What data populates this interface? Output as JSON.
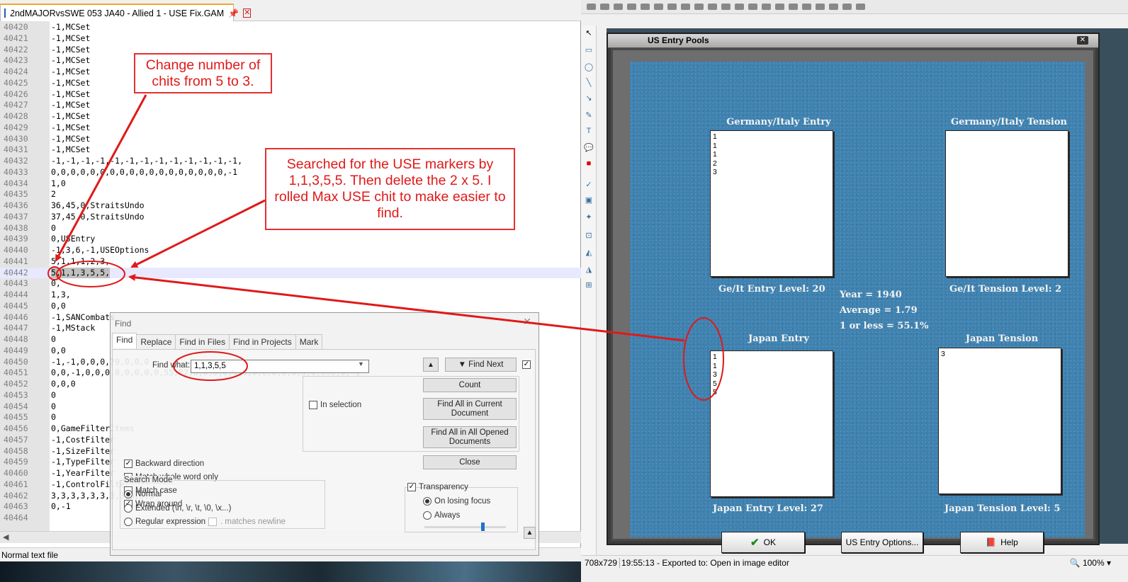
{
  "editor_file": {
    "tab_title": "2ndMAJORvsSWE 053 JA40 - Allied 1 - USE Fix.GAM",
    "status": "Normal text file",
    "lines": [
      {
        "n": "40420",
        "t": "-1,MCSet"
      },
      {
        "n": "40421",
        "t": "-1,MCSet"
      },
      {
        "n": "40422",
        "t": "-1,MCSet"
      },
      {
        "n": "40423",
        "t": "-1,MCSet"
      },
      {
        "n": "40424",
        "t": "-1,MCSet"
      },
      {
        "n": "40425",
        "t": "-1,MCSet"
      },
      {
        "n": "40426",
        "t": "-1,MCSet"
      },
      {
        "n": "40427",
        "t": "-1,MCSet"
      },
      {
        "n": "40428",
        "t": "-1,MCSet"
      },
      {
        "n": "40429",
        "t": "-1,MCSet"
      },
      {
        "n": "40430",
        "t": "-1,MCSet"
      },
      {
        "n": "40431",
        "t": "-1,MCSet"
      },
      {
        "n": "40432",
        "t": "-1,-1,-1,-1,-1,-1,-1,-1,-1,-1,-1,-1,-1,"
      },
      {
        "n": "40433",
        "t": "0,0,0,0,0,0,0,0,0,0,0,0,0,0,0,0,0,0,-1"
      },
      {
        "n": "40434",
        "t": "1,0"
      },
      {
        "n": "40435",
        "t": "2"
      },
      {
        "n": "40436",
        "t": "36,45,0,StraitsUndo"
      },
      {
        "n": "40437",
        "t": "37,45,0,StraitsUndo"
      },
      {
        "n": "40438",
        "t": "0"
      },
      {
        "n": "40439",
        "t": "0,USEntry"
      },
      {
        "n": "40440",
        "t": "-1,3,6,-1,USEOptions"
      },
      {
        "n": "40441",
        "t": "5,1,1,1,2,3,"
      },
      {
        "n": "40442",
        "t": "5,1,1,3,5,5,"
      },
      {
        "n": "40443",
        "t": "0,"
      },
      {
        "n": "40444",
        "t": "1,3,"
      },
      {
        "n": "40445",
        "t": "0,0"
      },
      {
        "n": "40446",
        "t": "-1,SANCombats"
      },
      {
        "n": "40447",
        "t": "-1,MStack"
      },
      {
        "n": "40448",
        "t": "0"
      },
      {
        "n": "40449",
        "t": "0,0"
      },
      {
        "n": "40450",
        "t": "-1,-1,0,0,0,79,0,0,0"
      },
      {
        "n": "40451",
        "t": "0,0,-1,0,0,0,0,0,0,0,0,55,82,0,0,0,0,0,0,0,0,0,0,0,0,0,0,0,0,-1"
      },
      {
        "n": "40452",
        "t": "0,0,0"
      },
      {
        "n": "40453",
        "t": "0"
      },
      {
        "n": "40454",
        "t": "0"
      },
      {
        "n": "40455",
        "t": "0"
      },
      {
        "n": "40456",
        "t": "0,GameFilterItems"
      },
      {
        "n": "40457",
        "t": "-1,CostFilter"
      },
      {
        "n": "40458",
        "t": "-1,SizeFilter"
      },
      {
        "n": "40459",
        "t": "-1,TypeFilter"
      },
      {
        "n": "40460",
        "t": "-1,YearFilter"
      },
      {
        "n": "40461",
        "t": "-1,ControlFilter"
      },
      {
        "n": "40462",
        "t": "3,3,3,3,3,3,3,3,3,3,3"
      },
      {
        "n": "40463",
        "t": "0,-1"
      },
      {
        "n": "40464",
        "t": ""
      }
    ]
  },
  "find_dialog": {
    "title": "Find",
    "tabs": [
      "Find",
      "Replace",
      "Find in Files",
      "Find in Projects",
      "Mark"
    ],
    "find_what_label": "Find what:",
    "find_what_value": "1,1,3,5,5",
    "buttons": {
      "find_next": "▼ Find Next",
      "count": "Count",
      "find_all_current": "Find All in Current Document",
      "find_all_opened": "Find All in All Opened Documents",
      "close": "Close"
    },
    "in_selection": "In selection",
    "options": [
      {
        "label": "Backward direction",
        "checked": true
      },
      {
        "label": "Match whole word only",
        "checked": false
      },
      {
        "label": "Match case",
        "checked": false
      },
      {
        "label": "Wrap around",
        "checked": true
      }
    ],
    "search_mode_label": "Search Mode",
    "search_modes": [
      {
        "label": "Normal",
        "selected": true
      },
      {
        "label": "Extended (\\n, \\r, \\t, \\0, \\x...)",
        "selected": false
      },
      {
        "label": "Regular expression",
        "selected": false
      }
    ],
    "matches_newline": ". matches newline",
    "transparency_label": "Transparency",
    "transparency_modes": [
      {
        "label": "On losing focus",
        "selected": true
      },
      {
        "label": "Always",
        "selected": false
      }
    ]
  },
  "image_editor": {
    "status_size": "708x729",
    "status_msg": "19:55:13 - Exported to: Open in image editor",
    "zoom": "100%"
  },
  "us_entry_pools": {
    "title": "US Entry Pools",
    "ge_it_entry": {
      "header": "Germany/Italy Entry",
      "chits": [
        "1",
        "1",
        "1",
        "2",
        "3"
      ],
      "level": "Ge/It Entry Level: 20"
    },
    "ge_it_tension": {
      "header": "Germany/Italy Tension",
      "chits": [],
      "level": "Ge/It Tension Level: 2"
    },
    "japan_entry": {
      "header": "Japan Entry",
      "chits": [
        "1",
        "1",
        "3",
        "5",
        "5"
      ],
      "level": "Japan Entry Level: 27"
    },
    "japan_tension": {
      "header": "Japan Tension",
      "chits": [
        "3"
      ],
      "level": "Japan Tension Level: 5"
    },
    "stats": {
      "year": "Year = 1940",
      "average": "Average = 1.79",
      "one_or_less": "1 or less = 55.1%"
    },
    "buttons": {
      "ok": "OK",
      "options": "US Entry Options...",
      "help": "Help"
    }
  },
  "annotations": {
    "callout1": "Change number of chits from 5 to 3.",
    "callout2": "Searched for the USE markers by 1,1,3,5,5. Then delete the 2 x 5. I rolled Max USE chit to make easier to find.",
    "color": "#e01919"
  }
}
